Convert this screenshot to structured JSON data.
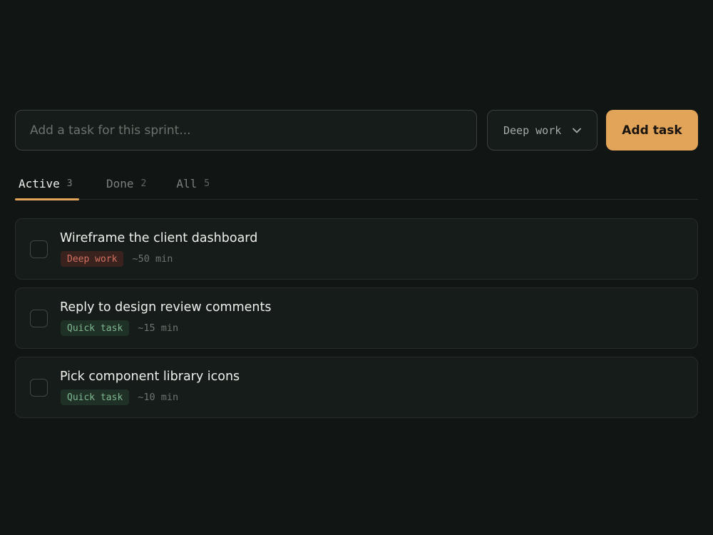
{
  "composer": {
    "placeholder": "Add a task for this sprint...",
    "type_select_value": "Deep work",
    "add_button_label": "Add task"
  },
  "tabs": [
    {
      "label": "Active",
      "count": "3"
    },
    {
      "label": "Done",
      "count": "2"
    },
    {
      "label": "All",
      "count": "5"
    }
  ],
  "tasks": [
    {
      "title": "Wireframe the client dashboard",
      "tag": "Deep work",
      "estimate": "~50 min"
    },
    {
      "title": "Reply to design review comments",
      "tag": "Quick task",
      "estimate": "~15 min"
    },
    {
      "title": "Pick component library icons",
      "tag": "Quick task",
      "estimate": "~10 min"
    }
  ],
  "colors": {
    "background": "#111614",
    "accent": "#e1a458",
    "deep_work_tag": "#d3705f",
    "quick_task_tag": "#7fb890"
  },
  "icons": {
    "select_chevron": "chevron-down-icon"
  }
}
